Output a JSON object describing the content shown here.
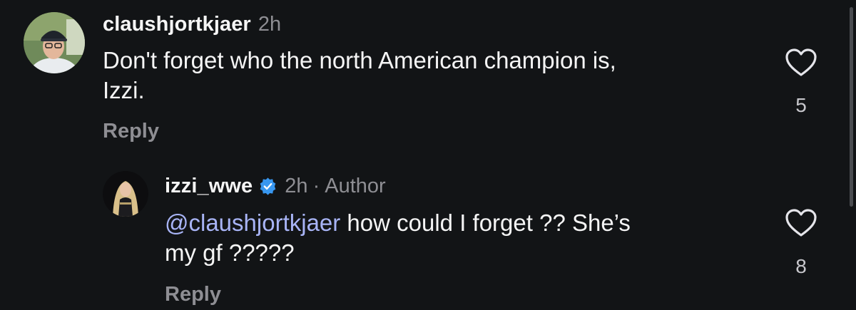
{
  "comments": [
    {
      "username": "claushjortkjaer",
      "time": "2h",
      "body": "Don't forget who the north American champion is,\nIzzi.",
      "reply_label": "Reply",
      "like_count": "5",
      "like_icon": "heart-outline-icon"
    },
    {
      "username": "izzi_wwe",
      "verified": true,
      "time": "2h",
      "separator": "·",
      "author_label": "Author",
      "mention": "@claushjortkjaer",
      "body": " how could I forget ?? She’s\nmy gf ?????",
      "reply_label": "Reply",
      "like_count": "8",
      "like_icon": "heart-outline-icon"
    }
  ],
  "colors": {
    "background": "#121416",
    "text": "#f5f5f5",
    "muted": "#8e8e93",
    "mention": "#a8b4f6",
    "verified": "#3897f0"
  }
}
